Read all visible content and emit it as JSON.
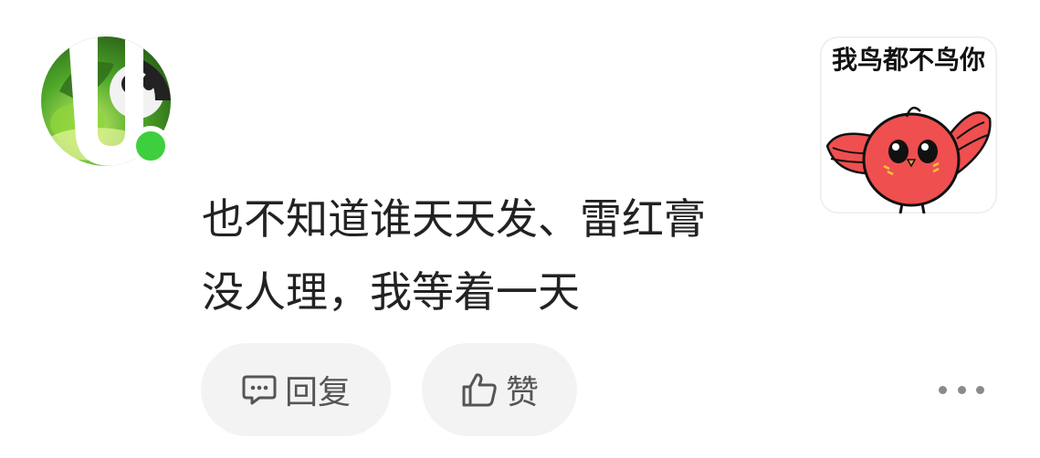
{
  "avatar": {
    "icon": "user-avatar",
    "status_color": "#3dcf3d"
  },
  "comment": {
    "line1": "也不知道谁天天发、雷红膏",
    "line2": "没人理，我等着一天"
  },
  "sticker": {
    "caption": "我鸟都不鸟你",
    "icon": "red-bird-sticker"
  },
  "actions": {
    "reply_label": "回复",
    "like_label": "赞",
    "reply_icon": "comment-bubble-icon",
    "like_icon": "thumbs-up-icon",
    "more_icon": "more-dots-icon"
  }
}
